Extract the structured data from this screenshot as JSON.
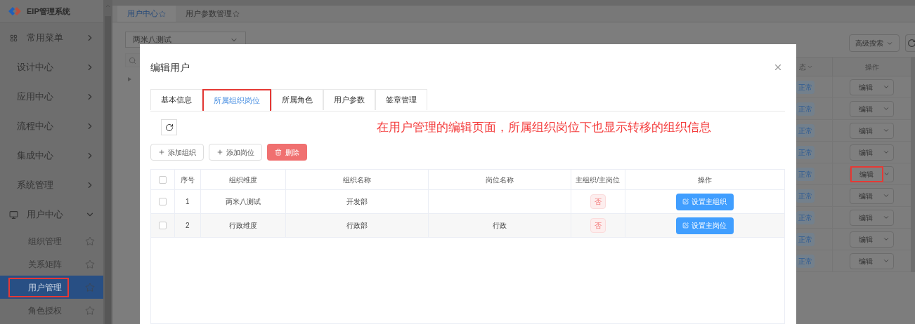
{
  "sidebar": {
    "logo_text": "EIP管理系统",
    "items": [
      {
        "label": "常用菜单",
        "kind": "favorites",
        "expanded": false
      },
      {
        "label": "设计中心",
        "kind": "module",
        "expanded": false
      },
      {
        "label": "应用中心",
        "kind": "module",
        "expanded": false
      },
      {
        "label": "流程中心",
        "kind": "module",
        "expanded": false
      },
      {
        "label": "集成中心",
        "kind": "module",
        "expanded": false
      },
      {
        "label": "系统管理",
        "kind": "module",
        "expanded": false
      },
      {
        "label": "用户中心",
        "kind": "group",
        "expanded": true,
        "children": [
          {
            "label": "组织管理",
            "selected": false,
            "highlighted": false
          },
          {
            "label": "关系矩阵",
            "selected": false,
            "highlighted": false
          },
          {
            "label": "用户管理",
            "selected": true,
            "highlighted": true
          },
          {
            "label": "角色授权",
            "selected": false,
            "highlighted": false
          }
        ]
      }
    ]
  },
  "page_tabs": [
    {
      "label": "用户中心",
      "selected": true
    },
    {
      "label": "用户参数管理",
      "selected": false
    }
  ],
  "org_select": {
    "value": "两米八测试"
  },
  "toolbar": {
    "advanced_search": "高级搜索"
  },
  "user_table": {
    "columns": [
      "态",
      "操作"
    ],
    "rows": [
      {
        "status": "正常",
        "action": "编辑",
        "highlighted": false
      },
      {
        "status": "正常",
        "action": "编辑",
        "highlighted": false
      },
      {
        "status": "正常",
        "action": "编辑",
        "highlighted": false
      },
      {
        "status": "正常",
        "action": "编辑",
        "highlighted": false
      },
      {
        "status": "正常",
        "action": "编辑",
        "highlighted": true
      },
      {
        "status": "正常",
        "action": "编辑",
        "highlighted": false
      },
      {
        "status": "正常",
        "action": "编辑",
        "highlighted": false
      },
      {
        "status": "正常",
        "action": "编辑",
        "highlighted": false
      },
      {
        "status": "正常",
        "action": "编辑",
        "highlighted": false
      }
    ]
  },
  "dialog": {
    "title": "编辑用户",
    "tabs": [
      {
        "label": "基本信息",
        "selected": false,
        "highlighted": false
      },
      {
        "label": "所属组织岗位",
        "selected": true,
        "highlighted": true
      },
      {
        "label": "所属角色",
        "selected": false,
        "highlighted": false
      },
      {
        "label": "用户参数",
        "selected": false,
        "highlighted": false
      },
      {
        "label": "签章管理",
        "selected": false,
        "highlighted": false
      }
    ],
    "annotation": "在用户管理的编辑页面，所属组织岗位下也显示转移的组织信息",
    "buttons": [
      {
        "label": "添加组织",
        "kind": "add"
      },
      {
        "label": "添加岗位",
        "kind": "add"
      },
      {
        "label": "删除",
        "kind": "danger"
      }
    ],
    "table": {
      "all_checked": false,
      "columns": [
        "序号",
        "组织维度",
        "组织名称",
        "岗位名称",
        "主组织/主岗位",
        "操作"
      ],
      "rows": [
        {
          "checked": false,
          "index": "1",
          "dimension": "两米八测试",
          "org": "开发部",
          "post": "",
          "main": "否",
          "action": "设置主组织"
        },
        {
          "checked": false,
          "index": "2",
          "dimension": "行政维度",
          "org": "行政部",
          "post": "行政",
          "main": "否",
          "action": "设置主岗位"
        }
      ]
    }
  }
}
